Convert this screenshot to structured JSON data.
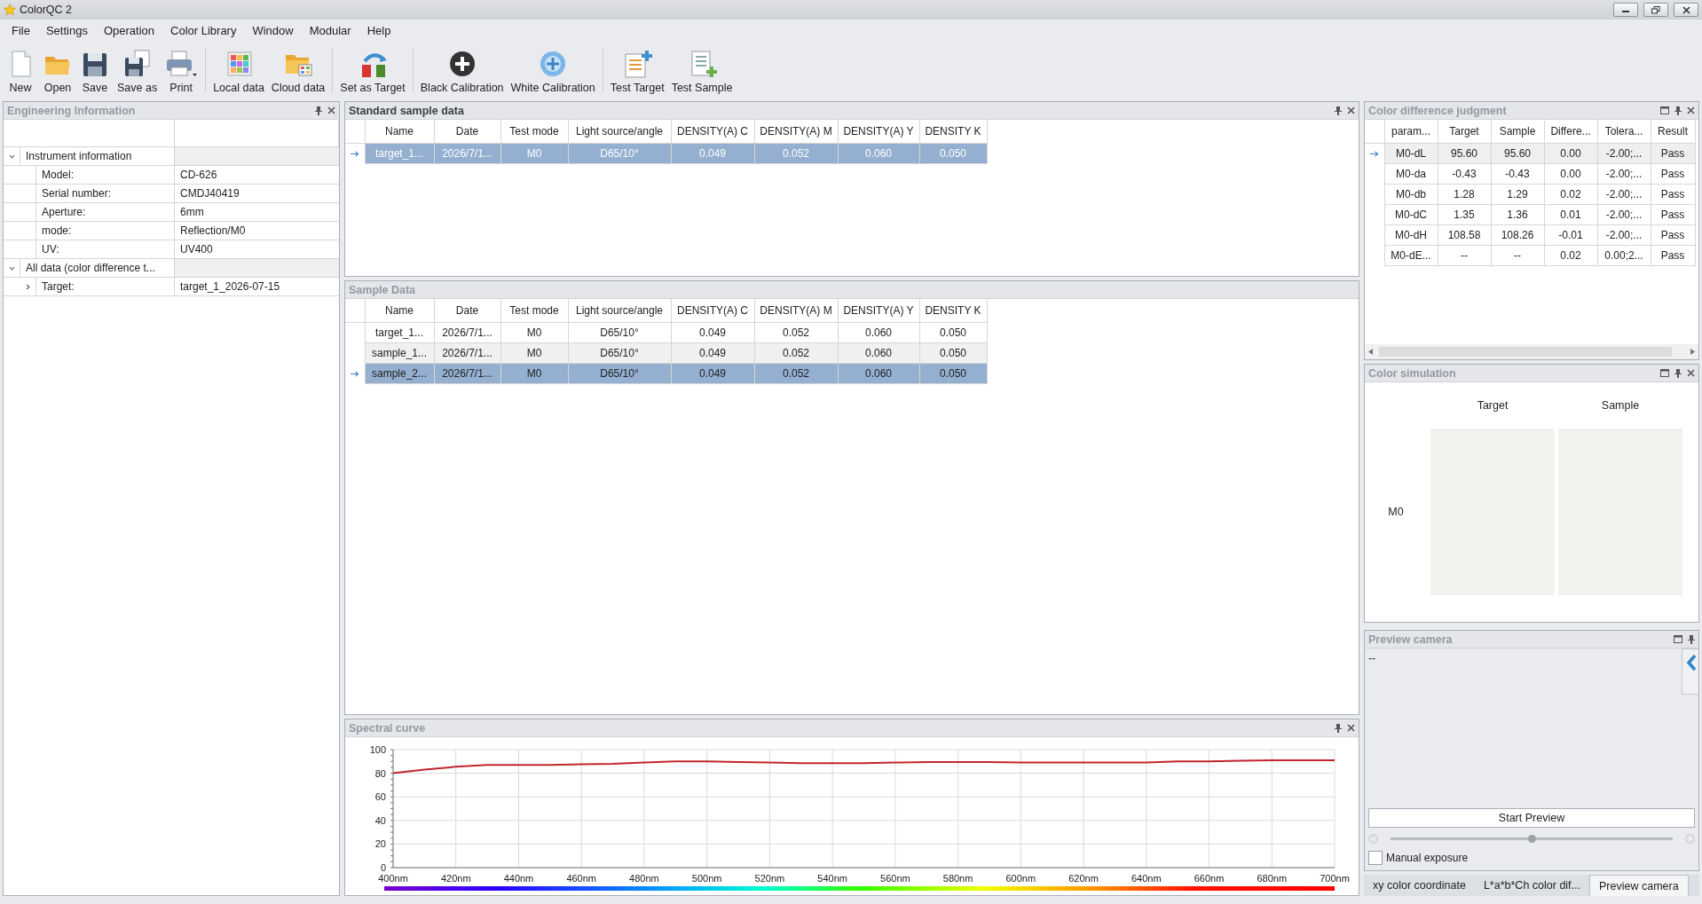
{
  "window": {
    "title": "ColorQC 2"
  },
  "menu": [
    "File",
    "Settings",
    "Operation",
    "Color Library",
    "Window",
    "Modular",
    "Help"
  ],
  "toolbar": [
    {
      "label": "New",
      "kind": "new"
    },
    {
      "label": "Open",
      "kind": "open"
    },
    {
      "label": "Save",
      "kind": "save"
    },
    {
      "label": "Save as",
      "kind": "saveas"
    },
    {
      "label": "Print",
      "kind": "print"
    },
    {
      "label": "Local data",
      "kind": "local"
    },
    {
      "label": "Cloud data",
      "kind": "cloud"
    },
    {
      "label": "Set as Target",
      "kind": "settarget"
    },
    {
      "label": "Black Calibration",
      "kind": "blackcal"
    },
    {
      "label": "White Calibration",
      "kind": "whitecal"
    },
    {
      "label": "Test Target",
      "kind": "testtarget"
    },
    {
      "label": "Test Sample",
      "kind": "testsample"
    }
  ],
  "engineering_info": {
    "title": "Engineering Information",
    "active": false,
    "tree": [
      {
        "label": "Instrument information",
        "expanded": true,
        "children": [
          {
            "label": "Model:",
            "value": "CD-626"
          },
          {
            "label": "Serial number:",
            "value": "CMDJ40419"
          },
          {
            "label": "Aperture:",
            "value": "6mm"
          },
          {
            "label": "mode:",
            "value": "Reflection/M0"
          },
          {
            "label": "UV:",
            "value": "UV400"
          }
        ]
      },
      {
        "label": "All data (color difference t...",
        "expanded": true,
        "children": [
          {
            "label": "Target:",
            "value": "target_1_2026-07-15",
            "expanded": false
          }
        ]
      }
    ]
  },
  "standard_sample_data": {
    "title": "Standard sample data",
    "active": true,
    "columns": [
      "Name",
      "Date",
      "Test mode",
      "Light source/angle",
      "DENSITY(A) C",
      "DENSITY(A) M",
      "DENSITY(A) Y",
      "DENSITY K"
    ],
    "rows": [
      {
        "selected": true,
        "cells": [
          "target_1...",
          "2026/7/1...",
          "M0",
          "D65/10°",
          "0.049",
          "0.052",
          "0.060",
          "0.050"
        ]
      }
    ]
  },
  "sample_data": {
    "title": "Sample Data",
    "active": false,
    "columns": [
      "Name",
      "Date",
      "Test mode",
      "Light source/angle",
      "DENSITY(A) C",
      "DENSITY(A) M",
      "DENSITY(A) Y",
      "DENSITY K"
    ],
    "rows": [
      {
        "selected": false,
        "cells": [
          "target_1...",
          "2026/7/1...",
          "M0",
          "D65/10°",
          "0.049",
          "0.052",
          "0.060",
          "0.050"
        ]
      },
      {
        "selected": false,
        "cells": [
          "sample_1...",
          "2026/7/1...",
          "M0",
          "D65/10°",
          "0.049",
          "0.052",
          "0.060",
          "0.050"
        ]
      },
      {
        "selected": true,
        "cells": [
          "sample_2...",
          "2026/7/1...",
          "M0",
          "D65/10°",
          "0.049",
          "0.052",
          "0.060",
          "0.050"
        ]
      }
    ]
  },
  "spectral_curve": {
    "title": "Spectral curve",
    "active": false,
    "chart_data": {
      "type": "line",
      "x": [
        400,
        410,
        420,
        430,
        440,
        450,
        460,
        470,
        480,
        490,
        500,
        510,
        520,
        530,
        540,
        550,
        560,
        570,
        580,
        590,
        600,
        610,
        620,
        630,
        640,
        650,
        660,
        670,
        680,
        690,
        700
      ],
      "grid": true,
      "series": [
        {
          "color": "#c0262d",
          "values": [
            80,
            83,
            85.5,
            87,
            87,
            87,
            87.5,
            88,
            89,
            90,
            90,
            89.5,
            89,
            88.5,
            88.5,
            88.5,
            89,
            89.5,
            89.5,
            89.5,
            89,
            89,
            89,
            89,
            89,
            90,
            90,
            90.5,
            91,
            91,
            91
          ]
        }
      ],
      "xlim": [
        400,
        700
      ],
      "ylim": [
        0,
        100
      ],
      "xticks": [
        {
          "value": 400,
          "label": "400nm"
        },
        {
          "value": 420,
          "label": "420nm"
        },
        {
          "value": 440,
          "label": "440nm"
        },
        {
          "value": 460,
          "label": "460nm"
        },
        {
          "value": 480,
          "label": "480nm"
        },
        {
          "value": 500,
          "label": "500nm"
        },
        {
          "value": 520,
          "label": "520nm"
        },
        {
          "value": 540,
          "label": "540nm"
        },
        {
          "value": 560,
          "label": "560nm"
        },
        {
          "value": 580,
          "label": "580nm"
        },
        {
          "value": 600,
          "label": "600nm"
        },
        {
          "value": 620,
          "label": "620nm"
        },
        {
          "value": 640,
          "label": "640nm"
        },
        {
          "value": 660,
          "label": "660nm"
        },
        {
          "value": 680,
          "label": "680nm"
        },
        {
          "value": 700,
          "label": "700nm"
        }
      ],
      "yticks": [
        0,
        20,
        40,
        60,
        80,
        100
      ]
    }
  },
  "color_difference": {
    "title": "Color difference judgment",
    "active": false,
    "columns": [
      "param...",
      "Target",
      "Sample",
      "Differe...",
      "Tolera...",
      "Result"
    ],
    "rows": [
      {
        "selected": true,
        "cells": [
          "M0-dL",
          "95.60",
          "95.60",
          "0.00",
          "-2.00;...",
          "Pass"
        ]
      },
      {
        "selected": false,
        "cells": [
          "M0-da",
          "-0.43",
          "-0.43",
          "0.00",
          "-2.00;...",
          "Pass"
        ]
      },
      {
        "selected": false,
        "cells": [
          "M0-db",
          "1.28",
          "1.29",
          "0.02",
          "-2.00;...",
          "Pass"
        ]
      },
      {
        "selected": false,
        "cells": [
          "M0-dC",
          "1.35",
          "1.36",
          "0.01",
          "-2.00;...",
          "Pass"
        ]
      },
      {
        "selected": false,
        "cells": [
          "M0-dH",
          "108.58",
          "108.26",
          "-0.01",
          "-2.00;...",
          "Pass"
        ]
      },
      {
        "selected": false,
        "cells": [
          "M0-dE...",
          "--",
          "--",
          "0.02",
          "0.00;2...",
          "Pass"
        ]
      }
    ]
  },
  "color_simulation": {
    "title": "Color simulation",
    "active": false,
    "headers": [
      "Target",
      "Sample"
    ],
    "rows": [
      {
        "label": "M0",
        "swatches": [
          {
            "color": "#f1f1ee"
          },
          {
            "color": "#f1f1ee"
          }
        ]
      }
    ]
  },
  "preview_camera": {
    "title": "Preview camera",
    "active": false,
    "status": "--",
    "button": "Start Preview",
    "exposure": {
      "level": 0.5
    },
    "manual_exposure": {
      "label": "Manual exposure",
      "checked": false
    }
  },
  "bottom_tabs": [
    {
      "label": "xy color coordinate",
      "selected": false
    },
    {
      "label": "L*a*b*Ch color dif...",
      "selected": false
    },
    {
      "label": "Preview camera",
      "selected": true
    }
  ]
}
